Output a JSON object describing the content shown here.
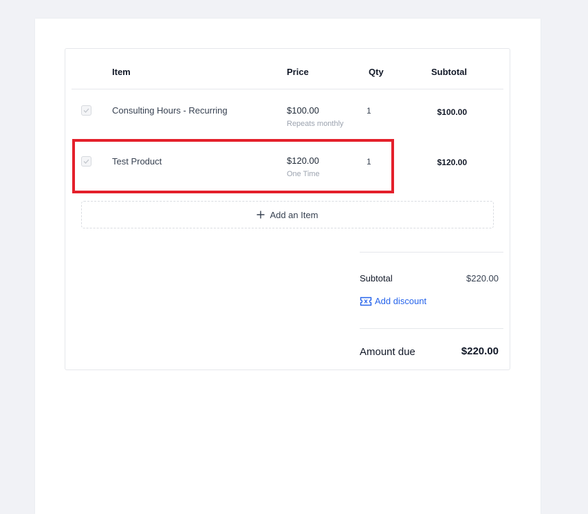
{
  "table": {
    "headers": {
      "item": "Item",
      "price": "Price",
      "qty": "Qty",
      "subtotal": "Subtotal"
    },
    "rows": [
      {
        "name": "Consulting Hours - Recurring",
        "price": "$100.00",
        "billing": "Repeats monthly",
        "qty": "1",
        "subtotal": "$100.00",
        "checked": true
      },
      {
        "name": "Test Product",
        "price": "$120.00",
        "billing": "One Time",
        "qty": "1",
        "subtotal": "$120.00",
        "checked": true,
        "highlighted": true
      }
    ],
    "add_item_label": "Add an Item"
  },
  "summary": {
    "subtotal_label": "Subtotal",
    "subtotal_value": "$220.00",
    "discount_label": "Add discount",
    "amount_due_label": "Amount due",
    "amount_due_value": "$220.00"
  },
  "colors": {
    "highlight": "#e4202b",
    "link": "#2563eb",
    "page_background": "#f1f2f6"
  },
  "icons": {
    "checkbox": "check-icon",
    "add": "plus-icon",
    "discount": "ticket-icon"
  }
}
